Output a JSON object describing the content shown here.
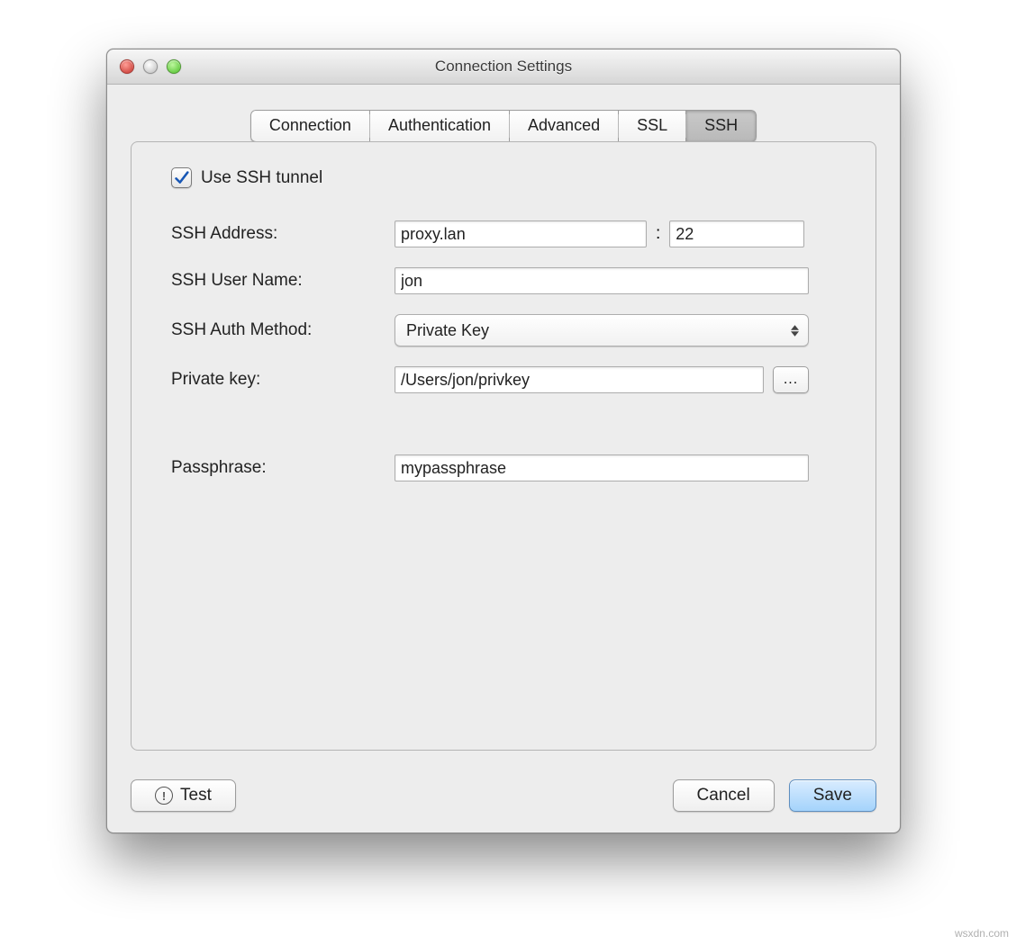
{
  "window": {
    "title": "Connection Settings"
  },
  "tabs": {
    "items": [
      "Connection",
      "Authentication",
      "Advanced",
      "SSL",
      "SSH"
    ],
    "active": 4
  },
  "ssh": {
    "use_tunnel_label": "Use SSH tunnel",
    "use_tunnel_checked": true,
    "address_label": "SSH Address:",
    "address_value": "proxy.lan",
    "port_value": "22",
    "username_label": "SSH User Name:",
    "username_value": "jon",
    "auth_method_label": "SSH Auth Method:",
    "auth_method_value": "Private Key",
    "private_key_label": "Private key:",
    "private_key_value": "/Users/jon/privkey",
    "browse_label": "...",
    "passphrase_label": "Passphrase:",
    "passphrase_value": "mypassphrase"
  },
  "footer": {
    "test": "Test",
    "cancel": "Cancel",
    "save": "Save"
  },
  "watermark": "wsxdn.com"
}
